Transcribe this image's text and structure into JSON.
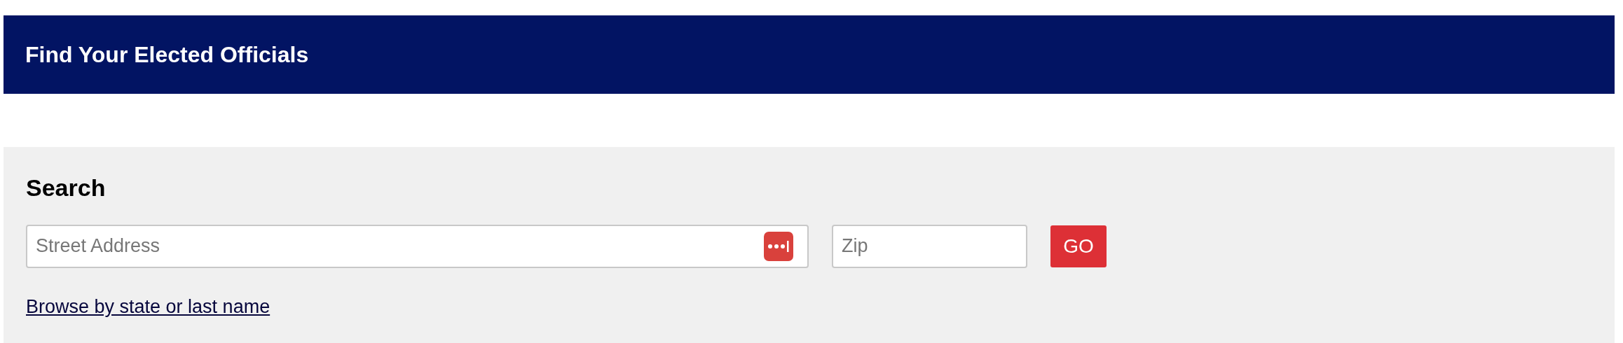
{
  "header": {
    "title": "Find Your Elected Officials"
  },
  "search": {
    "heading": "Search",
    "street": {
      "placeholder": "Street Address"
    },
    "zip": {
      "placeholder": "Zip"
    },
    "go_button": "GO",
    "browse_link": "Browse by state or last name"
  }
}
